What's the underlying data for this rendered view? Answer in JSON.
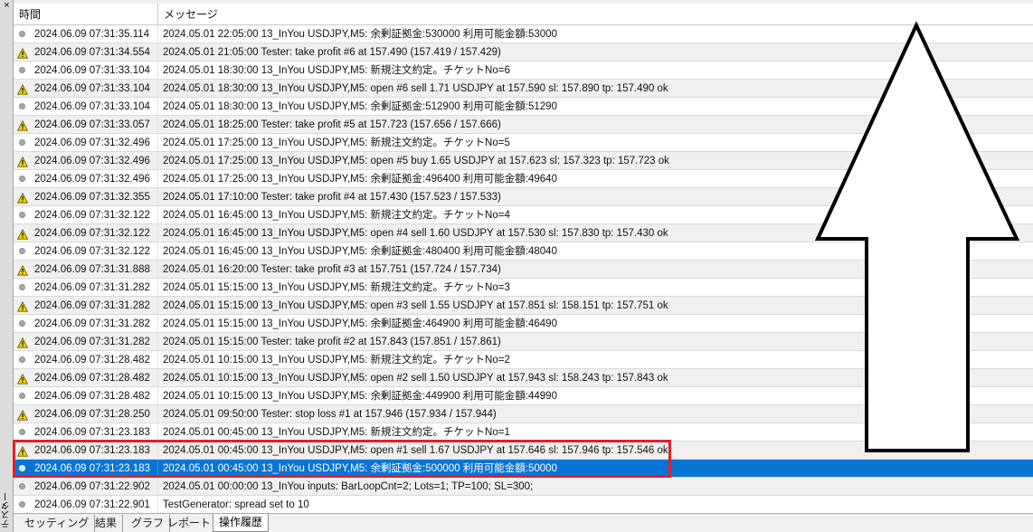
{
  "sidebar": {
    "close_glyph": "×",
    "title": "テスター"
  },
  "header": {
    "time_col": "時間",
    "message_col": "メッセージ"
  },
  "rows": [
    {
      "icon": "dot",
      "time": "2024.06.09 07:31:35.114",
      "message": "2024.05.01 22:05:00   13_InYou USDJPY,M5: 余剰証拠金:530000 利用可能金額:53000"
    },
    {
      "icon": "warn",
      "time": "2024.06.09 07:31:34.554",
      "message": "2024.05.01 21:05:00   Tester: take profit #6 at 157.490 (157.419 / 157.429)"
    },
    {
      "icon": "dot",
      "time": "2024.06.09 07:31:33.104",
      "message": "2024.05.01 18:30:00   13_InYou USDJPY,M5: 新規注文約定。チケットNo=6"
    },
    {
      "icon": "warn",
      "time": "2024.06.09 07:31:33.104",
      "message": "2024.05.01 18:30:00   13_InYou USDJPY,M5: open #6 sell 1.71 USDJPY at 157.590 sl: 157.890 tp: 157.490 ok"
    },
    {
      "icon": "dot",
      "time": "2024.06.09 07:31:33.104",
      "message": "2024.05.01 18:30:00   13_InYou USDJPY,M5: 余剰証拠金:512900 利用可能金額:51290"
    },
    {
      "icon": "warn",
      "time": "2024.06.09 07:31:33.057",
      "message": "2024.05.01 18:25:00   Tester: take profit #5 at 157.723 (157.656 / 157.666)"
    },
    {
      "icon": "dot",
      "time": "2024.06.09 07:31:32.496",
      "message": "2024.05.01 17:25:00   13_InYou USDJPY,M5: 新規注文約定。チケットNo=5"
    },
    {
      "icon": "warn",
      "time": "2024.06.09 07:31:32.496",
      "message": "2024.05.01 17:25:00   13_InYou USDJPY,M5: open #5 buy 1.65 USDJPY at 157.623 sl: 157.323 tp: 157.723 ok"
    },
    {
      "icon": "dot",
      "time": "2024.06.09 07:31:32.496",
      "message": "2024.05.01 17:25:00   13_InYou USDJPY,M5: 余剰証拠金:496400 利用可能金額:49640"
    },
    {
      "icon": "warn",
      "time": "2024.06.09 07:31:32.355",
      "message": "2024.05.01 17:10:00   Tester: take profit #4 at 157.430 (157.523 / 157.533)"
    },
    {
      "icon": "dot",
      "time": "2024.06.09 07:31:32.122",
      "message": "2024.05.01 16:45:00   13_InYou USDJPY,M5: 新規注文約定。チケットNo=4"
    },
    {
      "icon": "warn",
      "time": "2024.06.09 07:31:32.122",
      "message": "2024.05.01 16:45:00   13_InYou USDJPY,M5: open #4 sell 1.60 USDJPY at 157.530 sl: 157.830 tp: 157.430 ok"
    },
    {
      "icon": "dot",
      "time": "2024.06.09 07:31:32.122",
      "message": "2024.05.01 16:45:00   13_InYou USDJPY,M5: 余剰証拠金:480400 利用可能金額:48040"
    },
    {
      "icon": "warn",
      "time": "2024.06.09 07:31:31.888",
      "message": "2024.05.01 16:20:00   Tester: take profit #3 at 157.751 (157.724 / 157.734)"
    },
    {
      "icon": "dot",
      "time": "2024.06.09 07:31:31.282",
      "message": "2024.05.01 15:15:00   13_InYou USDJPY,M5: 新規注文約定。チケットNo=3"
    },
    {
      "icon": "warn",
      "time": "2024.06.09 07:31:31.282",
      "message": "2024.05.01 15:15:00   13_InYou USDJPY,M5: open #3 sell 1.55 USDJPY at 157.851 sl: 158.151 tp: 157.751 ok"
    },
    {
      "icon": "dot",
      "time": "2024.06.09 07:31:31.282",
      "message": "2024.05.01 15:15:00   13_InYou USDJPY,M5: 余剰証拠金:464900 利用可能金額:46490"
    },
    {
      "icon": "warn",
      "time": "2024.06.09 07:31:31.282",
      "message": "2024.05.01 15:15:00   Tester: take profit #2 at 157.843 (157.851 / 157.861)"
    },
    {
      "icon": "dot",
      "time": "2024.06.09 07:31:28.482",
      "message": "2024.05.01 10:15:00   13_InYou USDJPY,M5: 新規注文約定。チケットNo=2"
    },
    {
      "icon": "warn",
      "time": "2024.06.09 07:31:28.482",
      "message": "2024.05.01 10:15:00   13_InYou USDJPY,M5: open #2 sell 1.50 USDJPY at 157.943 sl: 158.243 tp: 157.843 ok"
    },
    {
      "icon": "dot",
      "time": "2024.06.09 07:31:28.482",
      "message": "2024.05.01 10:15:00   13_InYou USDJPY,M5: 余剰証拠金:449900 利用可能金額:44990"
    },
    {
      "icon": "warn",
      "time": "2024.06.09 07:31:28.250",
      "message": "2024.05.01 09:50:00   Tester: stop loss #1 at 157.946 (157.934 / 157.944)"
    },
    {
      "icon": "dot",
      "time": "2024.06.09 07:31:23.183",
      "message": "2024.05.01 00:45:00   13_InYou USDJPY,M5: 新規注文約定。チケットNo=1"
    },
    {
      "icon": "warn",
      "time": "2024.06.09 07:31:23.183",
      "message": "2024.05.01 00:45:00   13_InYou USDJPY,M5: open #1 sell 1.67 USDJPY at 157.646 sl: 157.946 tp: 157.546 ok"
    },
    {
      "icon": "dot",
      "time": "2024.06.09 07:31:23.183",
      "message": "2024.05.01 00:45:00   13_InYou USDJPY,M5: 余剰証拠金:500000 利用可能金額:50000",
      "selected": true
    },
    {
      "icon": "dot",
      "time": "2024.06.09 07:31:22.902",
      "message": "2024.05.01 00:00:00   13_InYou inputs: BarLoopCnt=2; Lots=1; TP=100; SL=300;"
    },
    {
      "icon": "dot",
      "time": "2024.06.09 07:31:22.901",
      "message": "TestGenerator: spread set to 10"
    }
  ],
  "tabs": [
    {
      "label": "セッティング"
    },
    {
      "label": "結果"
    },
    {
      "label": "グラフ"
    },
    {
      "label": "レポート"
    },
    {
      "label": "操作履歴",
      "active": true
    }
  ],
  "colors": {
    "selection": "#0a74d4",
    "highlight_box": "#e0202a",
    "warning_fill": "#f4d200",
    "row_alt": "#f0f0f0"
  }
}
